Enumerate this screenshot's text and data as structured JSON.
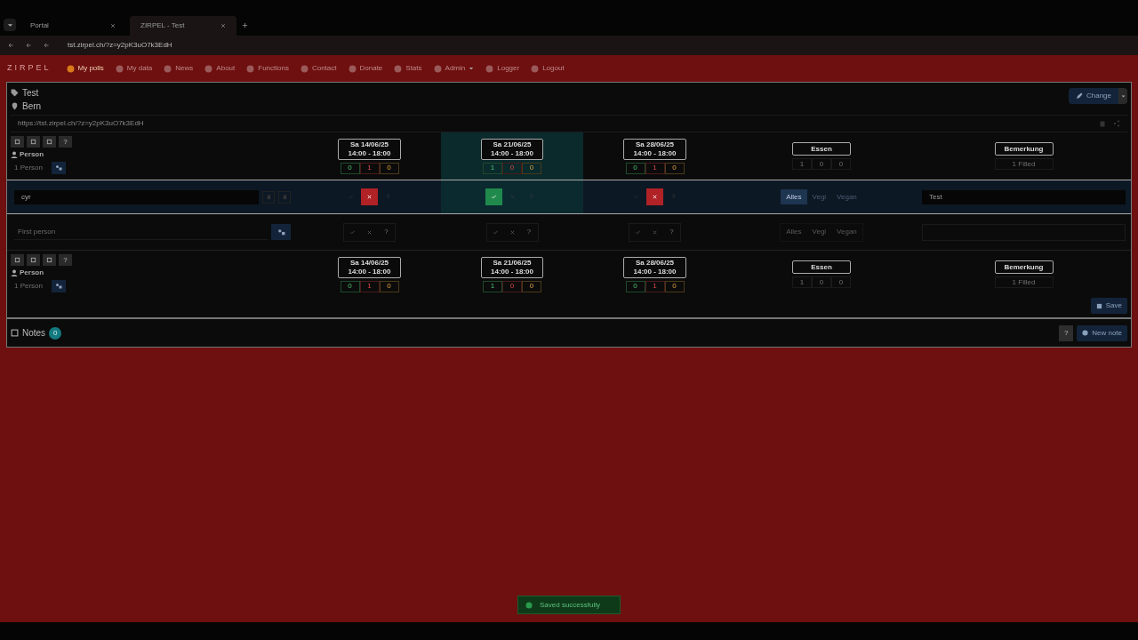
{
  "browser": {
    "tabs": [
      {
        "title": "Portal",
        "selected": false
      },
      {
        "title": "ZIRPEL - Test",
        "selected": true
      }
    ],
    "url": "tst.zirpel.ch/?z=y2pK3uO7k3EdH"
  },
  "nav": {
    "brand": "ZIRPEL",
    "items": [
      {
        "label": "My polls",
        "selected": true,
        "dropdown": false
      },
      {
        "label": "My data",
        "selected": false,
        "dropdown": false
      },
      {
        "label": "News",
        "selected": false,
        "dropdown": false
      },
      {
        "label": "About",
        "selected": false,
        "dropdown": false
      },
      {
        "label": "Functions",
        "selected": false,
        "dropdown": false
      },
      {
        "label": "Contact",
        "selected": false,
        "dropdown": false
      },
      {
        "label": "Donate",
        "selected": false,
        "dropdown": false
      },
      {
        "label": "Stats",
        "selected": false,
        "dropdown": false
      },
      {
        "label": "Admin",
        "selected": false,
        "dropdown": true
      },
      {
        "label": "Logger",
        "selected": false,
        "dropdown": false
      },
      {
        "label": "Logout",
        "selected": false,
        "dropdown": false
      }
    ]
  },
  "poll": {
    "title": "Test",
    "location": "Bern",
    "link": "https://tst.zirpel.ch/?z=y2pK3uO7k3EdH",
    "change_button": "Change"
  },
  "header": {
    "person_label": "Person",
    "help": "?",
    "person_count": "1 Person",
    "dates": [
      {
        "day": "Sa 14/06/25",
        "time": "14:00 - 18:00",
        "counts": [
          "0",
          "1",
          "0"
        ],
        "selected": false
      },
      {
        "day": "Sa 21/06/25",
        "time": "14:00 - 18:00",
        "counts": [
          "1",
          "0",
          "0"
        ],
        "selected": true
      },
      {
        "day": "Sa 28/06/25",
        "time": "14:00 - 18:00",
        "counts": [
          "0",
          "1",
          "0"
        ],
        "selected": false
      }
    ],
    "question": {
      "label": "Essen",
      "counts": [
        "1",
        "0",
        "0"
      ]
    },
    "remark": {
      "label": "Bemerkung",
      "count": "1 Filled"
    }
  },
  "entry": {
    "name": "cyr",
    "answers": [
      {
        "options": [
          {
            "kind": "yes",
            "selected": false
          },
          {
            "kind": "no",
            "selected": true
          },
          {
            "kind": "maybe",
            "selected": false
          }
        ]
      },
      {
        "options": [
          {
            "kind": "yes",
            "selected": true
          },
          {
            "kind": "no",
            "selected": false
          },
          {
            "kind": "maybe",
            "selected": false
          }
        ]
      },
      {
        "options": [
          {
            "kind": "yes",
            "selected": false
          },
          {
            "kind": "no",
            "selected": true
          },
          {
            "kind": "maybe",
            "selected": false
          }
        ]
      }
    ],
    "options": [
      {
        "label": "Alles",
        "selected": true
      },
      {
        "label": "Vegi",
        "selected": false
      },
      {
        "label": "Vegan",
        "selected": false
      }
    ],
    "remark": "Test"
  },
  "new_row": {
    "placeholder": "First person",
    "maybe_labels": [
      "?",
      "?",
      "?"
    ],
    "options": [
      "Alles",
      "Vegi",
      "Vegan"
    ]
  },
  "footer_header": {
    "person_label": "Person",
    "help": "?",
    "person_count": "1 Person",
    "dates": [
      {
        "day": "Sa 14/06/25",
        "time": "14:00 - 18:00",
        "counts": [
          "0",
          "1",
          "0"
        ],
        "selected": false
      },
      {
        "day": "Sa 21/06/25",
        "time": "14:00 - 18:00",
        "counts": [
          "1",
          "0",
          "0"
        ],
        "selected": false
      },
      {
        "day": "Sa 28/06/25",
        "time": "14:00 - 18:00",
        "counts": [
          "0",
          "1",
          "0"
        ],
        "selected": false
      }
    ],
    "question": {
      "label": "Essen",
      "counts": [
        "1",
        "0",
        "0"
      ]
    },
    "remark": {
      "label": "Bemerkung",
      "count": "1 Filled"
    }
  },
  "save_button": "Save",
  "notes": {
    "label": "Notes",
    "count": "0",
    "help": "?",
    "new_button": "New note"
  },
  "toast": "Saved successfully"
}
